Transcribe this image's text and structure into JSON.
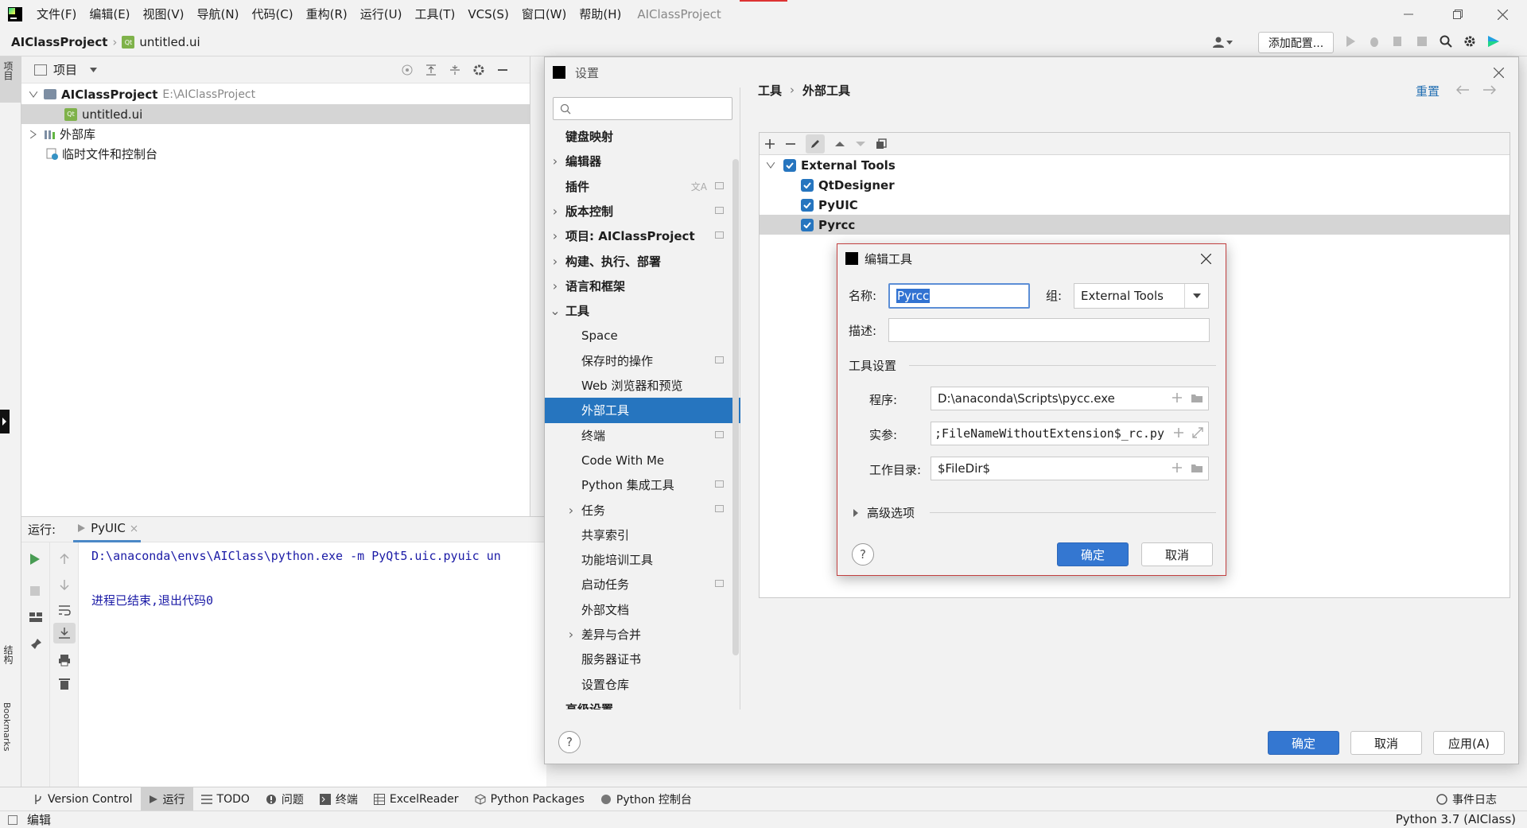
{
  "titlebar": {
    "menus": [
      "文件(F)",
      "编辑(E)",
      "视图(V)",
      "导航(N)",
      "代码(C)",
      "重构(R)",
      "运行(U)",
      "工具(T)",
      "VCS(S)",
      "窗口(W)",
      "帮助(H)"
    ],
    "app_title": "AIClassProject"
  },
  "navbar": {
    "project": "AIClassProject",
    "file": "untitled.ui",
    "add_config": "添加配置..."
  },
  "leftstrip": {
    "project_tab": "项目",
    "structure_tab": "结构",
    "bookmarks_tab": "Bookmarks"
  },
  "project_panel": {
    "header": "项目",
    "root_name": "AIClassProject",
    "root_path": "E:\\AIClassProject",
    "file": "untitled.ui",
    "external_libs": "外部库",
    "scratches": "临时文件和控制台"
  },
  "run_panel": {
    "label": "运行:",
    "tab": "PyUIC",
    "command": "D:\\anaconda\\envs\\AIClass\\python.exe -m PyQt5.uic.pyuic un",
    "exit_msg": "进程已结束,退出代码0"
  },
  "toolstrip": {
    "items": [
      "Version Control",
      "运行",
      "TODO",
      "问题",
      "终端",
      "ExcelReader",
      "Python Packages",
      "Python 控制台"
    ],
    "event_log": "事件日志"
  },
  "statusbar": {
    "mode": "编辑",
    "interpreter": "Python 3.7 (AIClass)"
  },
  "settings": {
    "title": "设置",
    "search_placeholder": "",
    "breadcrumb_root": "工具",
    "breadcrumb_leaf": "外部工具",
    "reset": "重置",
    "nav": [
      {
        "label": "键盘映射",
        "level": 0,
        "arrow": ""
      },
      {
        "label": "编辑器",
        "level": 0,
        "arrow": "right"
      },
      {
        "label": "插件",
        "level": 0,
        "arrow": ""
      },
      {
        "label": "版本控制",
        "level": 0,
        "arrow": "right"
      },
      {
        "label": "项目: AIClassProject",
        "level": 0,
        "arrow": "right"
      },
      {
        "label": "构建、执行、部署",
        "level": 0,
        "arrow": "right"
      },
      {
        "label": "语言和框架",
        "level": 0,
        "arrow": "right"
      },
      {
        "label": "工具",
        "level": 0,
        "arrow": "down"
      },
      {
        "label": "Space",
        "level": 1,
        "arrow": ""
      },
      {
        "label": "保存时的操作",
        "level": 1,
        "arrow": ""
      },
      {
        "label": "Web 浏览器和预览",
        "level": 1,
        "arrow": ""
      },
      {
        "label": "外部工具",
        "level": 1,
        "arrow": "",
        "selected": true
      },
      {
        "label": "终端",
        "level": 1,
        "arrow": ""
      },
      {
        "label": "Code With Me",
        "level": 1,
        "arrow": ""
      },
      {
        "label": "Python 集成工具",
        "level": 1,
        "arrow": ""
      },
      {
        "label": "任务",
        "level": 1,
        "arrow": "right"
      },
      {
        "label": "共享索引",
        "level": 1,
        "arrow": ""
      },
      {
        "label": "功能培训工具",
        "level": 1,
        "arrow": ""
      },
      {
        "label": "启动任务",
        "level": 1,
        "arrow": ""
      },
      {
        "label": "外部文档",
        "level": 1,
        "arrow": ""
      },
      {
        "label": "差异与合并",
        "level": 1,
        "arrow": "right"
      },
      {
        "label": "服务器证书",
        "level": 1,
        "arrow": ""
      },
      {
        "label": "设置仓库",
        "level": 1,
        "arrow": ""
      },
      {
        "label": "高级设置",
        "level": 0,
        "arrow": ""
      }
    ],
    "tools_group": "External Tools",
    "tools": [
      "QtDesigner",
      "PyUIC",
      "Pyrcc"
    ],
    "ok": "确定",
    "cancel": "取消",
    "apply": "应用(A)"
  },
  "edit_tool": {
    "title": "编辑工具",
    "name_label": "名称:",
    "name_value": "Pyrcc",
    "group_label": "组:",
    "group_value": "External Tools",
    "desc_label": "描述:",
    "desc_value": "",
    "section": "工具设置",
    "program_label": "程序:",
    "program_value": "D:\\anaconda\\Scripts\\pycc.exe",
    "args_label": "实参:",
    "args_value": ";FileNameWithoutExtension$_rc.py",
    "workdir_label": "工作目录:",
    "workdir_value": "$FileDir$",
    "advanced": "高级选项",
    "ok": "确定",
    "cancel": "取消"
  }
}
